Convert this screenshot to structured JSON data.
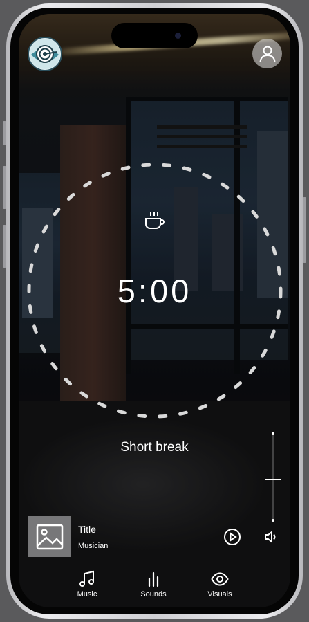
{
  "timer": {
    "display": "5:00",
    "mode_label": "Short break",
    "mode_icon": "coffee-cup-icon"
  },
  "header": {
    "logo_icon": "target-logo-icon",
    "profile_icon": "user-icon"
  },
  "volume": {
    "level": 0.48
  },
  "player": {
    "title": "Title",
    "artist": "Musician",
    "artwork_icon": "image-placeholder-icon",
    "play_icon": "play-circle-icon",
    "volume_icon": "speaker-icon"
  },
  "nav": {
    "items": [
      {
        "label": "Music",
        "icon": "music-note-icon"
      },
      {
        "label": "Sounds",
        "icon": "bars-icon"
      },
      {
        "label": "Visuals",
        "icon": "eye-icon"
      }
    ]
  },
  "colors": {
    "text": "#ffffff",
    "dash": "#d9d9d9",
    "artwork_bg": "#777779"
  }
}
